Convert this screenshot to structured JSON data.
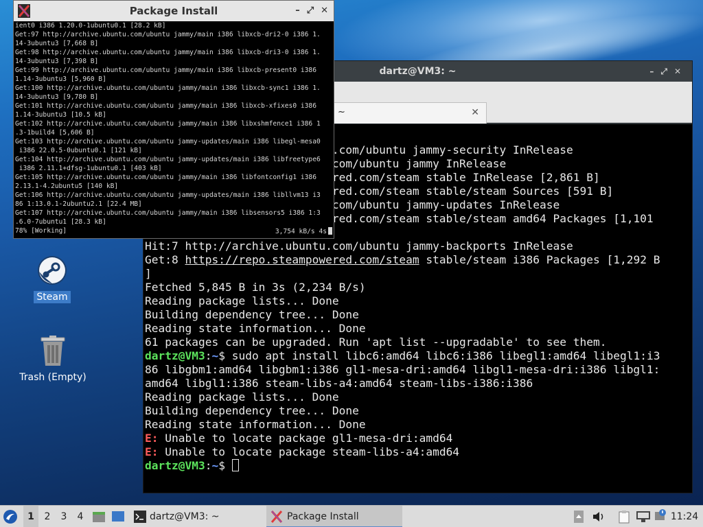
{
  "desktop": {
    "icons": [
      {
        "label": "Steam",
        "icon": "steam-icon"
      },
      {
        "label": "Trash (Empty)",
        "icon": "trash-icon"
      }
    ]
  },
  "terminal_window": {
    "title": "dartz@VM3: ~",
    "tab_label": "~",
    "lines": [
      {
        "parts": [
          {
            "t": ""
          }
        ]
      },
      {
        "parts": [
          {
            "t": "Hit:2 http://security.ubuntu.com/ubuntu jammy-security InRelease"
          }
        ]
      },
      {
        "parts": [
          {
            "t": "Hit:3 http://archive.ubuntu.com/ubuntu jammy InRelease"
          }
        ]
      },
      {
        "parts": [
          {
            "t": "Get:4 https://repo.steampowered.com/steam stable InRelease [2,861 B]"
          }
        ]
      },
      {
        "parts": [
          {
            "t": "Get:5 https://repo.steampowered.com/steam stable/steam Sources [591 B]"
          }
        ]
      },
      {
        "parts": [
          {
            "t": "Hit:6 http://archive.ubuntu.com/ubuntu jammy-updates InRelease"
          }
        ]
      },
      {
        "parts": [
          {
            "t": "Get:6 https://repo.steampowered.com/steam stable/steam amd64 Packages [1,101"
          }
        ]
      },
      {
        "parts": [
          {
            "t": "B]"
          }
        ]
      },
      {
        "parts": [
          {
            "t": "Hit:7 http://archive.ubuntu.com/ubuntu jammy-backports InRelease"
          }
        ]
      },
      {
        "parts": [
          {
            "t": "Get:8 "
          },
          {
            "t": "https://repo.steampowered.com/steam",
            "c": "link"
          },
          {
            "t": " stable/steam i386 Packages [1,292 B"
          }
        ]
      },
      {
        "parts": [
          {
            "t": "]"
          }
        ]
      },
      {
        "parts": [
          {
            "t": "Fetched 5,845 B in 3s (2,234 B/s)"
          }
        ]
      },
      {
        "parts": [
          {
            "t": "Reading package lists... Done"
          }
        ]
      },
      {
        "parts": [
          {
            "t": "Building dependency tree... Done"
          }
        ]
      },
      {
        "parts": [
          {
            "t": "Reading state information... Done"
          }
        ]
      },
      {
        "parts": [
          {
            "t": "61 packages can be upgraded. Run 'apt list --upgradable' to see them."
          }
        ]
      },
      {
        "parts": [
          {
            "t": "dartz@VM3",
            "c": "prompt-user"
          },
          {
            "t": ":"
          },
          {
            "t": "~",
            "c": "prompt-path"
          },
          {
            "t": "$ sudo apt install libc6:amd64 libc6:i386 libegl1:amd64 libegl1:i3"
          }
        ]
      },
      {
        "parts": [
          {
            "t": "86 libgbm1:amd64 libgbm1:i386 gl1-mesa-dri:amd64 libgl1-mesa-dri:i386 libgl1:"
          }
        ]
      },
      {
        "parts": [
          {
            "t": "amd64 libgl1:i386 steam-libs-a4:amd64 steam-libs-i386:i386"
          }
        ]
      },
      {
        "parts": [
          {
            "t": "Reading package lists... Done"
          }
        ]
      },
      {
        "parts": [
          {
            "t": "Building dependency tree... Done"
          }
        ]
      },
      {
        "parts": [
          {
            "t": "Reading state information... Done"
          }
        ]
      },
      {
        "parts": [
          {
            "t": "E:",
            "c": "err"
          },
          {
            "t": " Unable to locate package gl1-mesa-dri:amd64"
          }
        ]
      },
      {
        "parts": [
          {
            "t": "E:",
            "c": "err"
          },
          {
            "t": " Unable to locate package steam-libs-a4:amd64"
          }
        ]
      },
      {
        "parts": [
          {
            "t": "dartz@VM3",
            "c": "prompt-user"
          },
          {
            "t": ":"
          },
          {
            "t": "~",
            "c": "prompt-path"
          },
          {
            "t": "$ "
          },
          {
            "t": "",
            "c": "cursor"
          }
        ]
      }
    ]
  },
  "package_window": {
    "title": "Package Install",
    "lines": [
      "ient0 i386 1.20.0-1ubuntu0.1 [28.2 kB]",
      "Get:97 http://archive.ubuntu.com/ubuntu jammy/main i386 libxcb-dri2-0 i386 1.",
      "14-3ubuntu3 [7,668 B]",
      "Get:98 http://archive.ubuntu.com/ubuntu jammy/main i386 libxcb-dri3-0 i386 1.",
      "14-3ubuntu3 [7,398 B]",
      "Get:99 http://archive.ubuntu.com/ubuntu jammy/main i386 libxcb-present0 i386",
      "1.14-3ubuntu3 [5,960 B]",
      "Get:100 http://archive.ubuntu.com/ubuntu jammy/main i386 libxcb-sync1 i386 1.",
      "14-3ubuntu3 [9,780 B]",
      "Get:101 http://archive.ubuntu.com/ubuntu jammy/main i386 libxcb-xfixes0 i386",
      "1.14-3ubuntu3 [10.5 kB]",
      "Get:102 http://archive.ubuntu.com/ubuntu jammy/main i386 libxshmfence1 i386 1",
      ".3-1build4 [5,606 B]",
      "Get:103 http://archive.ubuntu.com/ubuntu jammy-updates/main i386 libegl-mesa0",
      " i386 22.0.5-0ubuntu0.1 [121 kB]",
      "Get:104 http://archive.ubuntu.com/ubuntu jammy-updates/main i386 libfreetype6",
      " i386 2.11.1+dfsg-1ubuntu0.1 [403 kB]",
      "Get:105 http://archive.ubuntu.com/ubuntu jammy/main i386 libfontconfig1 i386",
      "2.13.1-4.2ubuntu5 [140 kB]",
      "Get:106 http://archive.ubuntu.com/ubuntu jammy-updates/main i386 libllvm13 i3",
      "86 1:13.0.1-2ubuntu2.1 [22.4 MB]",
      "Get:107 http://archive.ubuntu.com/ubuntu jammy/main i386 libsensors5 i386 1:3",
      ".6.0-7ubuntu1 [28.3 kB]"
    ],
    "status_left": "78% [Working]",
    "status_right": "3,754 kB/s 4s"
  },
  "taskbar": {
    "workspaces": [
      "1",
      "2",
      "3",
      "4"
    ],
    "tasks": [
      {
        "label": "dartz@VM3: ~",
        "icon": "terminal-icon"
      },
      {
        "label": "Package Install",
        "icon": "xlogo-icon"
      }
    ],
    "clock": "11:24"
  },
  "colors": {
    "prompt_user": "#5ce35c",
    "prompt_path": "#6e9cff",
    "error": "#ff5c5c"
  }
}
